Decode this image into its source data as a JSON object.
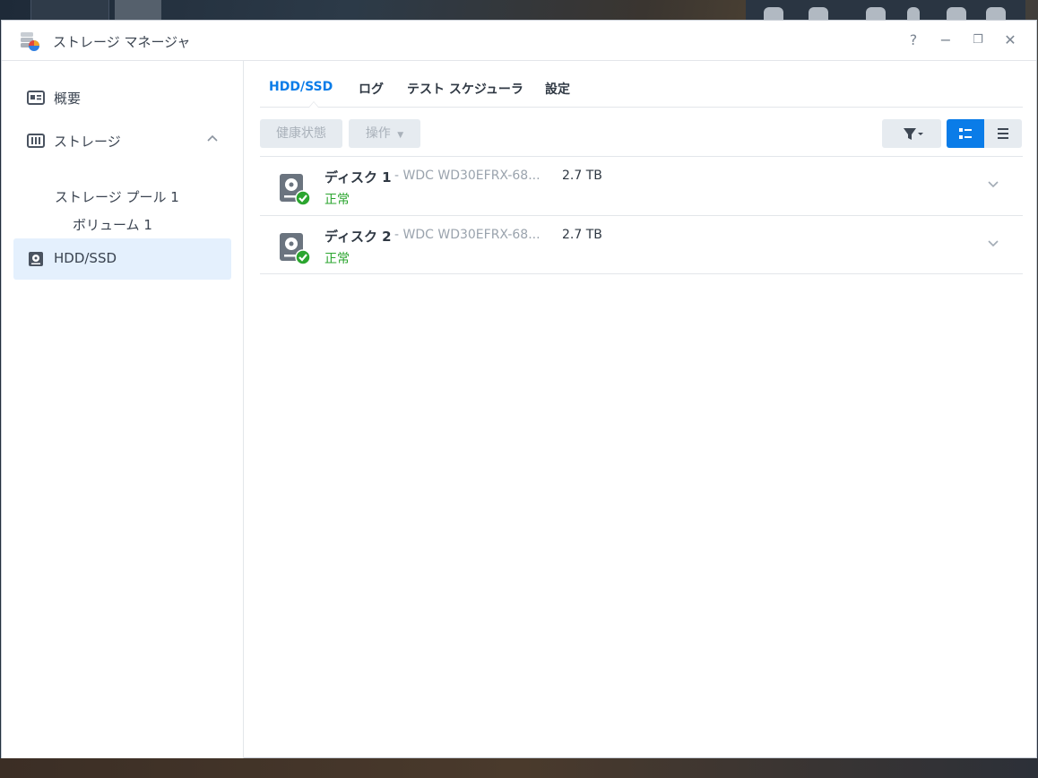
{
  "window": {
    "title": "ストレージ マネージャ",
    "controls": {
      "help": "?",
      "minimize": "−",
      "restore": "❐",
      "close": "✕"
    }
  },
  "sidebar": {
    "items": [
      {
        "label": "概要",
        "icon": "overview-icon"
      },
      {
        "label": "ストレージ",
        "icon": "storage-icon",
        "expanded": true
      },
      {
        "label": "HDD/SSD",
        "icon": "hdd-icon",
        "active": true
      }
    ],
    "storage_pool": "ストレージ プール 1",
    "volume": "ボリューム 1"
  },
  "tabs": [
    {
      "label": "HDD/SSD",
      "active": true
    },
    {
      "label": "ログ"
    },
    {
      "label": "テスト スケジューラ"
    },
    {
      "label": "設定"
    }
  ],
  "toolbar": {
    "health_label": "健康状態",
    "action_label": "操作"
  },
  "disks": [
    {
      "name": "ディスク 1",
      "separator": "-",
      "model": "WDC WD30EFRX-68...",
      "size": "2.7 TB",
      "status": "正常"
    },
    {
      "name": "ディスク 2",
      "separator": "-",
      "model": "WDC WD30EFRX-68...",
      "size": "2.7 TB",
      "status": "正常"
    }
  ],
  "colors": {
    "accent": "#0a7ce8",
    "status_ok": "#2ba52f",
    "active_nav_bg": "#e4f0fd"
  }
}
